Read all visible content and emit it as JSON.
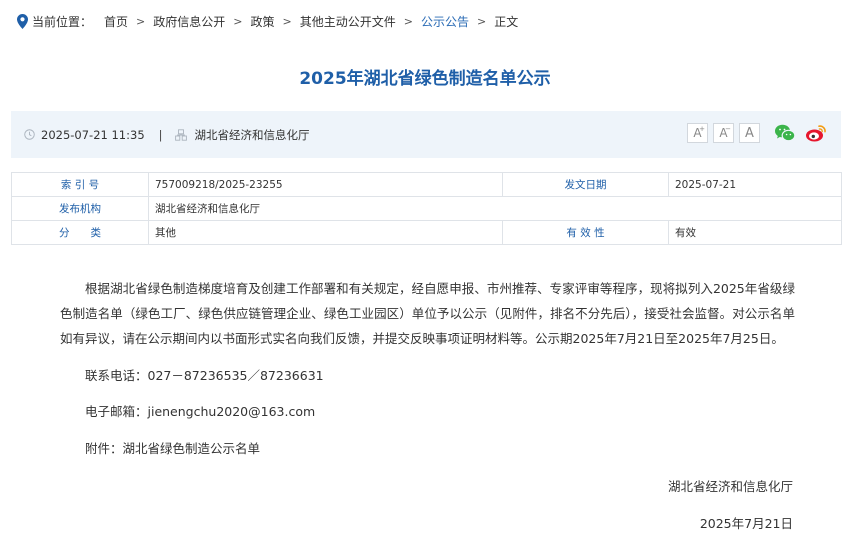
{
  "breadcrumb": {
    "prefix": "当前位置：",
    "items": [
      "首页",
      "政府信息公开",
      "政策",
      "其他主动公开文件",
      "公示公告",
      "正文"
    ],
    "separator": ">"
  },
  "title": "2025年湖北省绿色制造名单公示",
  "info": {
    "datetime": "2025-07-21 11:35",
    "divider": "|",
    "publisher": "湖北省经济和信息化厅",
    "font_buttons": [
      "A",
      "A",
      "A"
    ]
  },
  "meta": {
    "index_label": "索 引 号",
    "index_value": "757009218/2025-23255",
    "date_label": "发文日期",
    "date_value": "2025-07-21",
    "org_label": "发布机构",
    "org_value": "湖北省经济和信息化厅",
    "category_label": "分　　类",
    "category_value": "其他",
    "validity_label": "有 效 性",
    "validity_value": "有效"
  },
  "body": {
    "paragraph": "根据湖北省绿色制造梯度培育及创建工作部署和有关规定，经自愿申报、市州推荐、专家评审等程序，现将拟列入2025年省级绿色制造名单（绿色工厂、绿色供应链管理企业、绿色工业园区）单位予以公示（见附件，排名不分先后），接受社会监督。对公示名单如有异议，请在公示期间内以书面形式实名向我们反馈，并提交反映事项证明材料等。公示期2025年7月21日至2025年7月25日。",
    "phone": "联系电话：027－87236535／87236631",
    "email": "电子邮箱：jienengchu2020@163.com",
    "attachment_prefix": "附件：",
    "attachment_link": "湖北省绿色制造公示名单",
    "sign_org": "湖北省经济和信息化厅",
    "sign_date": "2025年7月21日"
  },
  "colors": {
    "accent": "#1f5fa8",
    "info_bg": "#eef4fa",
    "wechat": "#3bb44a",
    "weibo": "#e6162d"
  },
  "icons": [
    "location-pin-icon",
    "clock-icon",
    "org-icon",
    "wechat-icon",
    "weibo-icon"
  ]
}
